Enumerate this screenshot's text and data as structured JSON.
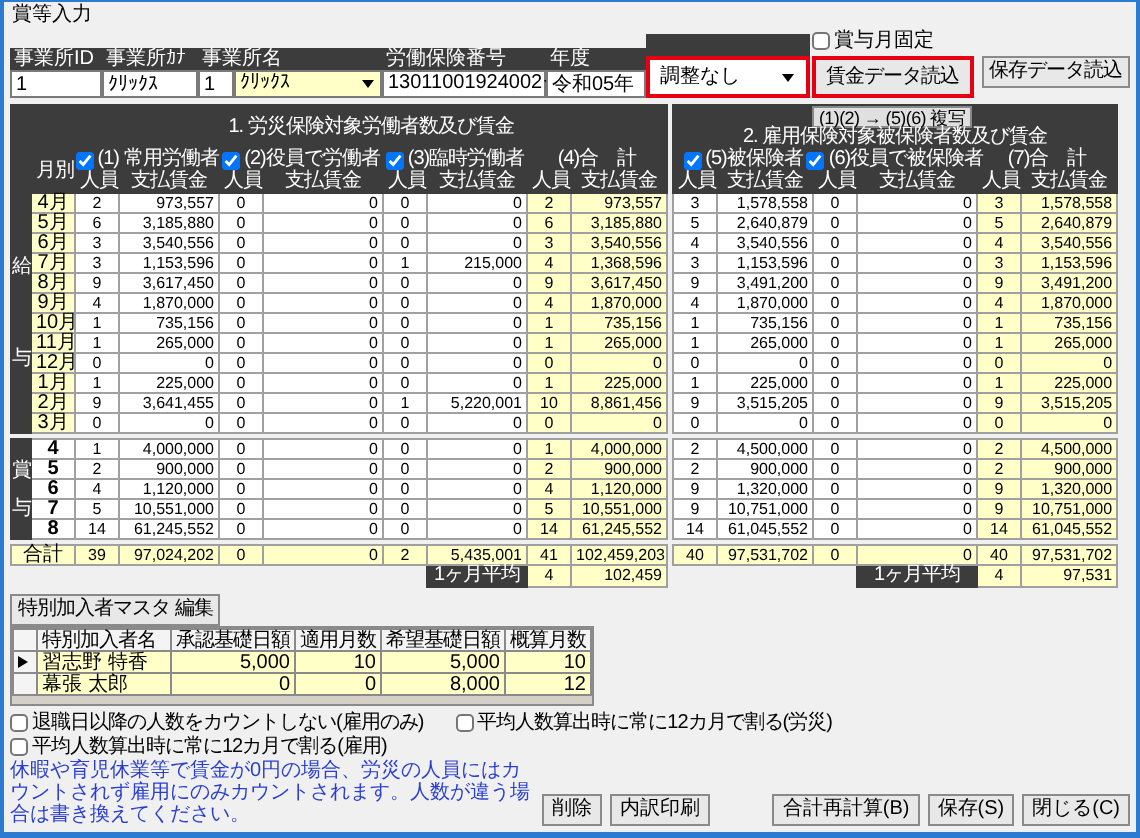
{
  "window": {
    "title": "賞等入力"
  },
  "fields": [
    {
      "label": "事業所ID",
      "kind": "text",
      "value": "1"
    },
    {
      "label": "事業所ｶﾅ",
      "kind": "text",
      "value": "ｸﾘｯｸｽ"
    },
    {
      "label": "事業所名",
      "kind": "code-select",
      "code": "1",
      "value": "ｸﾘｯｸｽ"
    },
    {
      "label": "労働保険番号",
      "kind": "select",
      "value": "13011001924002"
    },
    {
      "label": "年度",
      "kind": "text",
      "value": "令和05年"
    },
    {
      "kind": "select",
      "value": "調整なし",
      "highlighted": true
    }
  ],
  "bonus_month_fixed": {
    "label": "賞与月固定",
    "checked": false
  },
  "load_buttons": [
    {
      "label": "賃金データ読込",
      "highlighted": true
    },
    {
      "label": "保存データ読込",
      "highlighted": false
    }
  ],
  "wage_table": {
    "section1_title": "1. 労災保険対象労働者数及び賃金",
    "copy_button": "(1)(2) → (5)(6) 複写",
    "section2_title": "2. 雇用保険対象被保険者数及び賃金",
    "month_header": "月別",
    "groups": [
      {
        "label": "(1) 常用労働者",
        "kind": "check",
        "checked": true,
        "count_header": "人員",
        "wage_header": "支払賃金"
      },
      {
        "label": "(2)役員で労働者",
        "kind": "check",
        "checked": true,
        "count_header": "人員",
        "wage_header": "支払賃金"
      },
      {
        "label": "(3)臨時労働者",
        "kind": "check",
        "checked": true,
        "count_header": "人員",
        "wage_header": "支払賃金"
      },
      {
        "label": "(4)合　計",
        "kind": "total",
        "count_header": "人員",
        "wage_header": "支払賃金"
      },
      {
        "label": "(5)被保険者",
        "kind": "check",
        "checked": true,
        "count_header": "人員",
        "wage_header": "支払賃金"
      },
      {
        "label": "(6)役員で被保険者",
        "kind": "check",
        "checked": true,
        "count_header": "人員",
        "wage_header": "支払賃金"
      },
      {
        "label": "(7)合　計",
        "kind": "total",
        "count_header": "人員",
        "wage_header": "支払賃金"
      }
    ],
    "blocks": [
      {
        "label": "給与",
        "kind": "month",
        "rows": [
          {
            "month": "4月",
            "cells": [
              "2",
              "973,557",
              "0",
              "0",
              "0",
              "0",
              "2",
              "973,557",
              "3",
              "1,578,558",
              "0",
              "0",
              "3",
              "1,578,558"
            ]
          },
          {
            "month": "5月",
            "cells": [
              "6",
              "3,185,880",
              "0",
              "0",
              "0",
              "0",
              "6",
              "3,185,880",
              "5",
              "2,640,879",
              "0",
              "0",
              "5",
              "2,640,879"
            ]
          },
          {
            "month": "6月",
            "cells": [
              "3",
              "3,540,556",
              "0",
              "0",
              "0",
              "0",
              "3",
              "3,540,556",
              "4",
              "3,540,556",
              "0",
              "0",
              "4",
              "3,540,556"
            ]
          },
          {
            "month": "7月",
            "cells": [
              "3",
              "1,153,596",
              "0",
              "0",
              "1",
              "215,000",
              "4",
              "1,368,596",
              "3",
              "1,153,596",
              "0",
              "0",
              "3",
              "1,153,596"
            ]
          },
          {
            "month": "8月",
            "cells": [
              "9",
              "3,617,450",
              "0",
              "0",
              "0",
              "0",
              "9",
              "3,617,450",
              "9",
              "3,491,200",
              "0",
              "0",
              "9",
              "3,491,200"
            ]
          },
          {
            "month": "9月",
            "cells": [
              "4",
              "1,870,000",
              "0",
              "0",
              "0",
              "0",
              "4",
              "1,870,000",
              "4",
              "1,870,000",
              "0",
              "0",
              "4",
              "1,870,000"
            ]
          },
          {
            "month": "10月",
            "cells": [
              "1",
              "735,156",
              "0",
              "0",
              "0",
              "0",
              "1",
              "735,156",
              "1",
              "735,156",
              "0",
              "0",
              "1",
              "735,156"
            ]
          },
          {
            "month": "11月",
            "cells": [
              "1",
              "265,000",
              "0",
              "0",
              "0",
              "0",
              "1",
              "265,000",
              "1",
              "265,000",
              "0",
              "0",
              "1",
              "265,000"
            ]
          },
          {
            "month": "12月",
            "cells": [
              "0",
              "0",
              "0",
              "0",
              "0",
              "0",
              "0",
              "0",
              "0",
              "0",
              "0",
              "0",
              "0",
              "0"
            ]
          },
          {
            "month": "1月",
            "cells": [
              "1",
              "225,000",
              "0",
              "0",
              "0",
              "0",
              "1",
              "225,000",
              "1",
              "225,000",
              "0",
              "0",
              "1",
              "225,000"
            ]
          },
          {
            "month": "2月",
            "cells": [
              "9",
              "3,641,455",
              "0",
              "0",
              "1",
              "5,220,001",
              "10",
              "8,861,456",
              "9",
              "3,515,205",
              "0",
              "0",
              "9",
              "3,515,205"
            ]
          },
          {
            "month": "3月",
            "cells": [
              "0",
              "0",
              "0",
              "0",
              "0",
              "0",
              "0",
              "0",
              "0",
              "0",
              "0",
              "0",
              "0",
              "0"
            ]
          }
        ]
      },
      {
        "label": "賞与",
        "kind": "bonus",
        "rows": [
          {
            "month": "4",
            "cells": [
              "1",
              "4,000,000",
              "0",
              "0",
              "0",
              "0",
              "1",
              "4,000,000",
              "2",
              "4,500,000",
              "0",
              "0",
              "2",
              "4,500,000"
            ]
          },
          {
            "month": "5",
            "cells": [
              "2",
              "900,000",
              "0",
              "0",
              "0",
              "0",
              "2",
              "900,000",
              "2",
              "900,000",
              "0",
              "0",
              "2",
              "900,000"
            ]
          },
          {
            "month": "6",
            "cells": [
              "4",
              "1,120,000",
              "0",
              "0",
              "0",
              "0",
              "4",
              "1,120,000",
              "9",
              "1,320,000",
              "0",
              "0",
              "9",
              "1,320,000"
            ]
          },
          {
            "month": "7",
            "cells": [
              "5",
              "10,551,000",
              "0",
              "0",
              "0",
              "0",
              "5",
              "10,551,000",
              "9",
              "10,751,000",
              "0",
              "0",
              "9",
              "10,751,000"
            ]
          },
          {
            "month": "8",
            "cells": [
              "14",
              "61,245,552",
              "0",
              "0",
              "0",
              "0",
              "14",
              "61,245,552",
              "14",
              "61,045,552",
              "0",
              "0",
              "14",
              "61,045,552"
            ]
          }
        ]
      }
    ],
    "total": {
      "label": "合計",
      "cells": [
        "39",
        "97,024,202",
        "0",
        "0",
        "2",
        "5,435,001",
        "41",
        "102,459,203",
        "40",
        "97,531,702",
        "0",
        "0",
        "40",
        "97,531,702"
      ]
    },
    "averages": [
      {
        "label": "1ヶ月平均",
        "count": "4",
        "wage": "102,459"
      },
      {
        "label": "1ヶ月平均",
        "count": "4",
        "wage": "97,531"
      }
    ]
  },
  "special_members": {
    "edit_button": "特別加入者マスタ 編集",
    "columns": [
      "特別加入者名",
      "承認基礎日額",
      "適用月数",
      "希望基礎日額",
      "概算月数"
    ],
    "rows": [
      {
        "selected": true,
        "cells": [
          "習志野 特香",
          "5,000",
          "10",
          "5,000",
          "10"
        ]
      },
      {
        "selected": false,
        "cells": [
          "幕張 太郎",
          "0",
          "0",
          "8,000",
          "12"
        ]
      }
    ]
  },
  "options": [
    {
      "label": "退職日以降の人数をカウントしない(雇用のみ)",
      "checked": false
    },
    {
      "label": "平均人数算出時に常に12カ月で割る(労災)",
      "checked": false
    },
    {
      "label": "平均人数算出時に常に12カ月で割る(雇用)",
      "checked": false
    }
  ],
  "note": "休暇や育児休業等で賃金が0円の場合、労災の人員にはカウントされず雇用にのみカウントされます。人数が違う場合は書き換えてください。",
  "actions": [
    {
      "label": "削除",
      "kind": "left"
    },
    {
      "label": "内訳印刷",
      "kind": "left"
    },
    {
      "label": "合計再計算(B)",
      "kind": "right"
    },
    {
      "label": "保存(S)",
      "kind": "right"
    },
    {
      "label": "閉じる(C)",
      "kind": "right"
    }
  ]
}
